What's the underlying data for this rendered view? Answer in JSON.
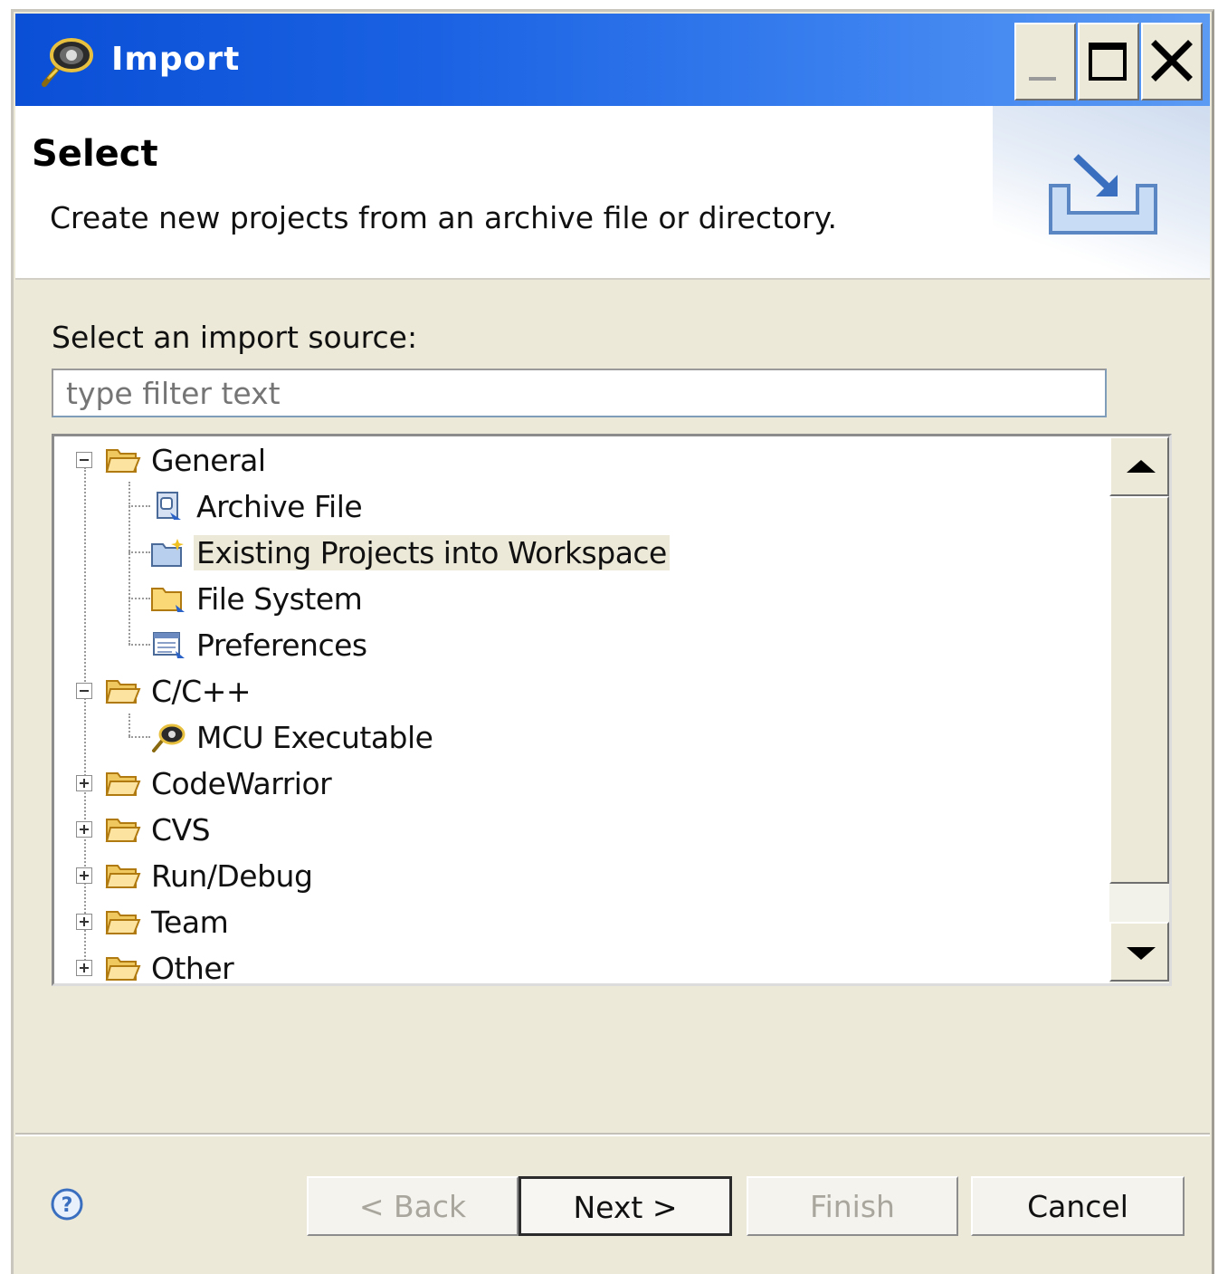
{
  "window": {
    "title": "Import",
    "controls": {
      "minimize": "minimize-icon",
      "maximize": "maximize-icon",
      "close": "close-icon"
    }
  },
  "header": {
    "title": "Select",
    "description": "Create new projects from an archive file or directory."
  },
  "source": {
    "label": "Select an import source:",
    "filter_placeholder": "type filter text"
  },
  "tree": {
    "items": [
      {
        "label": "General",
        "level": 0,
        "expanded": true,
        "icon": "folder-open-icon"
      },
      {
        "label": "Archive File",
        "level": 1,
        "icon": "archive-file-icon"
      },
      {
        "label": "Existing Projects into Workspace",
        "level": 1,
        "icon": "existing-projects-icon",
        "selected": true
      },
      {
        "label": "File System",
        "level": 1,
        "icon": "file-system-folder-icon"
      },
      {
        "label": "Preferences",
        "level": 1,
        "icon": "preferences-icon"
      },
      {
        "label": "C/C++",
        "level": 0,
        "expanded": true,
        "icon": "folder-open-icon"
      },
      {
        "label": "MCU Executable",
        "level": 1,
        "icon": "mcu-executable-icon"
      },
      {
        "label": "CodeWarrior",
        "level": 0,
        "expanded": false,
        "icon": "folder-open-icon"
      },
      {
        "label": "CVS",
        "level": 0,
        "expanded": false,
        "icon": "folder-open-icon"
      },
      {
        "label": "Run/Debug",
        "level": 0,
        "expanded": false,
        "icon": "folder-open-icon"
      },
      {
        "label": "Team",
        "level": 0,
        "expanded": false,
        "icon": "folder-open-icon"
      },
      {
        "label": "Other",
        "level": 0,
        "expanded": false,
        "icon": "folder-open-icon"
      }
    ]
  },
  "footer": {
    "help_icon": "help-icon",
    "back_label": "< Back",
    "next_label": "Next >",
    "finish_label": "Finish",
    "cancel_label": "Cancel"
  },
  "colors": {
    "titlebar_start": "#0a4fd6",
    "titlebar_end": "#5c9bf4",
    "dialog_bg": "#ece9d8",
    "selection_bg": "#ece9d8"
  }
}
